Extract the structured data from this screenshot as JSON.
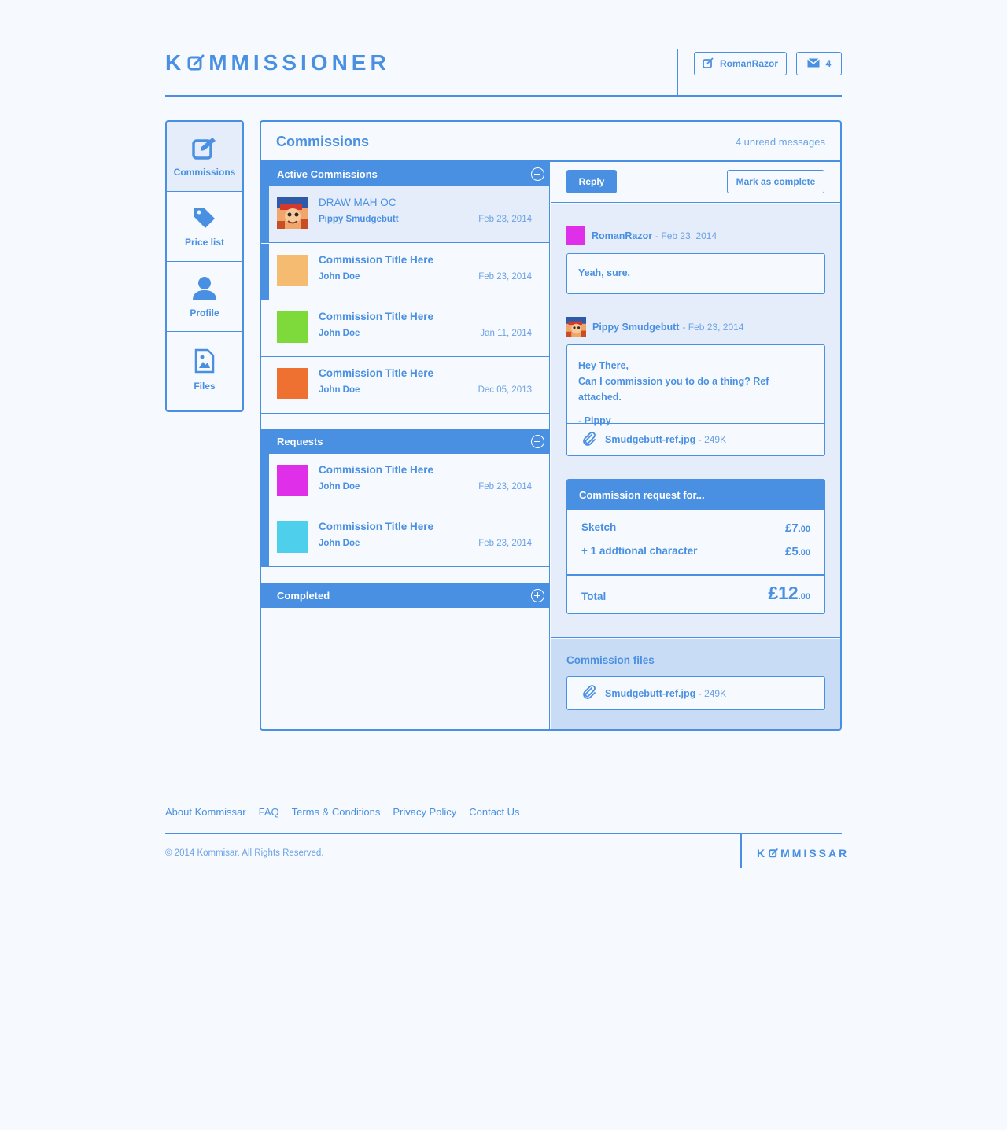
{
  "header": {
    "logo_pre": "K",
    "logo_post": "MMISSIONER",
    "user_label": "RomanRazor",
    "mail_count": "4"
  },
  "sidebar": {
    "items": [
      {
        "label": "Commissions",
        "icon": "edit-icon"
      },
      {
        "label": "Price list",
        "icon": "tag-icon"
      },
      {
        "label": "Profile",
        "icon": "user-icon"
      },
      {
        "label": "Files",
        "icon": "image-file-icon"
      }
    ]
  },
  "panel": {
    "title": "Commissions",
    "unread": "4 unread messages"
  },
  "sections": {
    "active": "Active Commissions",
    "requests": "Requests",
    "completed": "Completed"
  },
  "active_rows": [
    {
      "title": "DRAW MAH OC",
      "name": "Pippy Smudgebutt",
      "date": "Feb 23, 2014",
      "color": "avatar"
    },
    {
      "title": "Commission Title Here",
      "name": "John Doe",
      "date": "Feb 23, 2014",
      "color": "#f5bb70"
    },
    {
      "title": "Commission Title Here",
      "name": "John Doe",
      "date": "Jan 11, 2014",
      "color": "#7ed93a"
    },
    {
      "title": "Commission Title Here",
      "name": "John Doe",
      "date": "Dec 05, 2013",
      "color": "#ef7131"
    }
  ],
  "request_rows": [
    {
      "title": "Commission Title Here",
      "name": "John Doe",
      "date": "Feb 23, 2014",
      "color": "#df2fe9"
    },
    {
      "title": "Commission Title Here",
      "name": "John Doe",
      "date": "Feb 23, 2014",
      "color": "#4ecfec"
    }
  ],
  "toolbar": {
    "reply": "Reply",
    "complete": "Mark as complete"
  },
  "messages": [
    {
      "author": "RomanRazor",
      "date": "- Feb 23, 2014",
      "text": "Yeah, sure.",
      "avatar_color": "#df2fe9"
    },
    {
      "author": "Pippy Smudgebutt",
      "date": "- Feb 23, 2014",
      "line1": "Hey There,",
      "line2": "Can I commission you to do a thing? Ref attached.",
      "sign": "- Pippy",
      "attachment": "Smudgebutt-ref.jpg",
      "attachment_size": "- 249K"
    }
  ],
  "request": {
    "title": "Commission request for...",
    "items": [
      {
        "label": "Sketch",
        "big": "£7",
        "small": ".00"
      },
      {
        "label": "+ 1 addtional character",
        "big": "£5",
        "small": ".00"
      }
    ],
    "total_label": "Total",
    "total_big": "£12",
    "total_small": ".00"
  },
  "files": {
    "title": "Commission files",
    "name": "Smudgebutt-ref.jpg",
    "size": "- 249K"
  },
  "footer": {
    "links": [
      "About Kommissar",
      "FAQ",
      "Terms & Conditions",
      "Privacy Policy",
      "Contact Us"
    ],
    "copyright": "© 2014 Kommisar. All Rights Reserved.",
    "logo_pre": "K",
    "logo_post": "MMISSAR"
  },
  "colors": {
    "accent": "#4a90e2",
    "panel_light": "#e4edf9",
    "files_bg": "#c9dcf5"
  }
}
